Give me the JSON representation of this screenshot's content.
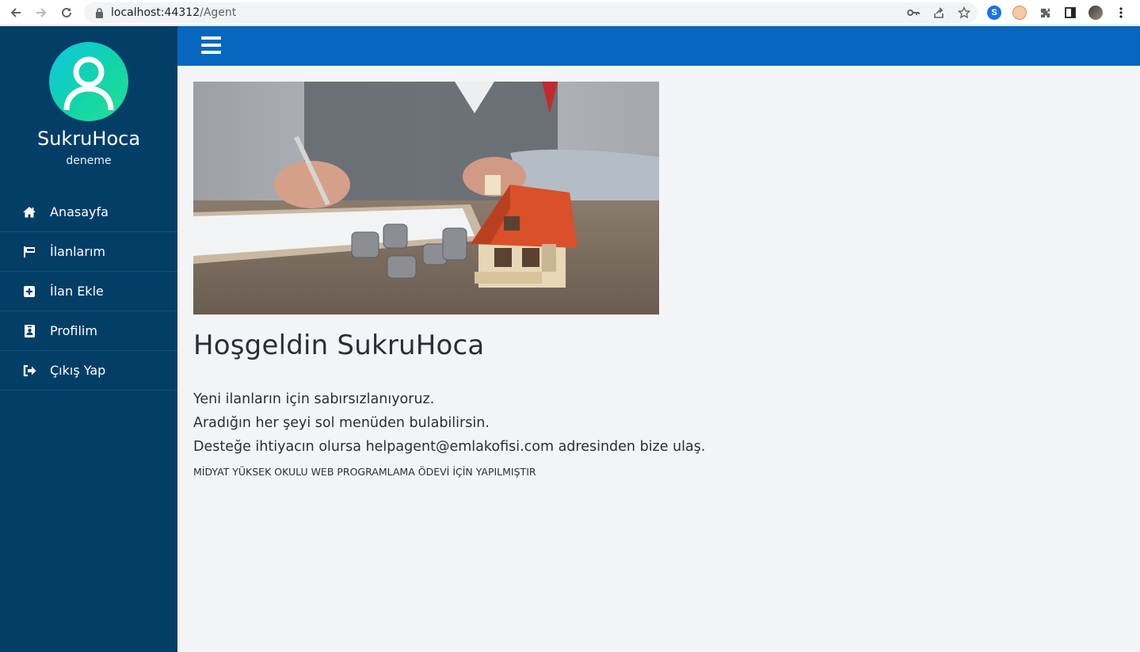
{
  "browser": {
    "url_host": "localhost:44312",
    "url_path": "/Agent"
  },
  "sidebar": {
    "user_name": "SukruHoca",
    "user_role": "deneme",
    "items": [
      {
        "label": "Anasayfa",
        "icon": "home-icon"
      },
      {
        "label": "İlanlarım",
        "icon": "flag-icon"
      },
      {
        "label": "İlan Ekle",
        "icon": "plus-square-icon"
      },
      {
        "label": "Profilim",
        "icon": "id-badge-icon"
      },
      {
        "label": "Çıkış Yap",
        "icon": "sign-out-icon"
      }
    ]
  },
  "main": {
    "hero_image_alt": "house model and coins on desk",
    "welcome_title": "Hoşgeldin SukruHoca",
    "lines": [
      "Yeni ilanların için sabırsızlanıyoruz.",
      "Aradığın her şeyi sol menüden bulabilirsin.",
      "Desteğe ihtiyacın olursa helpagent@emlakofisi.com adresinden bize ulaş."
    ],
    "footer_note": "MİDYAT YÜKSEK OKULU WEB PROGRAMLAMA ÖDEVİ İÇİN YAPILMIŞTIR"
  },
  "colors": {
    "sidebar_bg": "#033e67",
    "topbar_bg": "#0766bd",
    "content_bg": "#f3f4f8"
  }
}
